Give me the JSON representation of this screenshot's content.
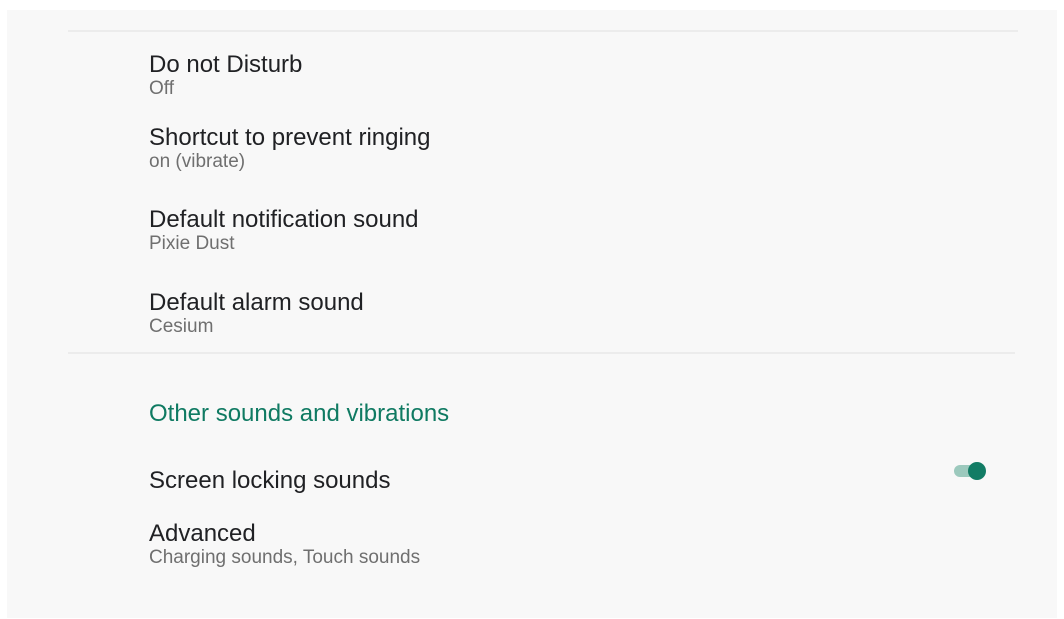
{
  "settings": {
    "dnd": {
      "title": "Do not Disturb",
      "summary": "Off"
    },
    "prevent_ringing": {
      "title": "Shortcut to prevent ringing",
      "summary": "on (vibrate)"
    },
    "notification_sound": {
      "title": "Default notification sound",
      "summary": "Pixie Dust"
    },
    "alarm_sound": {
      "title": "Default alarm sound",
      "summary": "Cesium"
    }
  },
  "other": {
    "header": "Other sounds and vibrations",
    "screen_lock": {
      "title": "Screen locking sounds",
      "enabled": true
    },
    "advanced": {
      "title": "Advanced",
      "summary": "Charging sounds, Touch sounds"
    }
  },
  "colors": {
    "accent": "#127c65",
    "accent_track": "#9cc9bd",
    "background": "#f8f8f8"
  }
}
